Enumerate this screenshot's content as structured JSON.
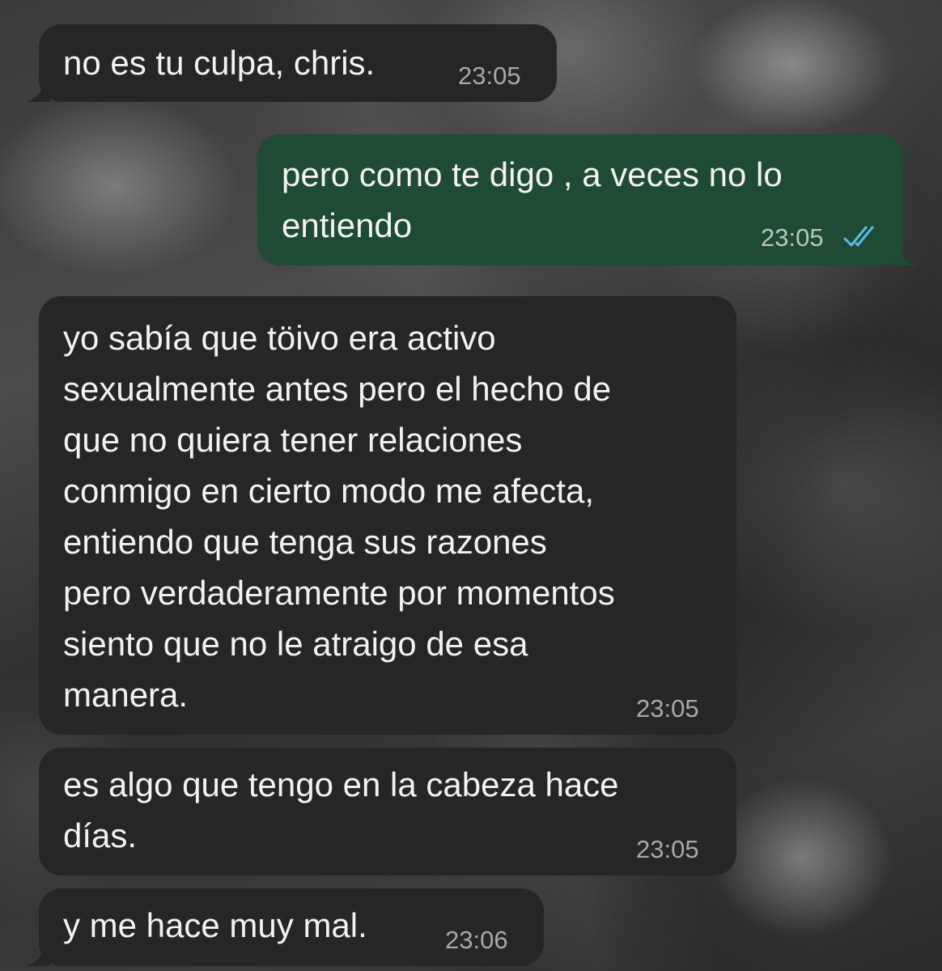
{
  "colors": {
    "incoming_bubble": "#262626",
    "outgoing_bubble": "#1f4a33",
    "read_ticks": "#53bdeb"
  },
  "messages": [
    {
      "direction": "incoming",
      "text": "no es tu culpa, chris.",
      "time": "23:05"
    },
    {
      "direction": "outgoing",
      "text": "pero como te digo , a veces no lo\nentiendo",
      "time": "23:05",
      "status_icon": "double-check-read-icon"
    },
    {
      "direction": "incoming",
      "text": "yo sabía que töivo era activo\nsexualmente antes pero el hecho de\nque no quiera tener relaciones\nconmigo en cierto modo me afecta,\nentiendo que tenga sus razones\npero verdaderamente por momentos\nsiento que no le atraigo de esa\nmanera.",
      "time": "23:05"
    },
    {
      "direction": "incoming",
      "text": "es algo que tengo en la cabeza hace\ndías.",
      "time": "23:05"
    },
    {
      "direction": "incoming",
      "text": "y me hace muy mal.",
      "time": "23:06"
    }
  ]
}
